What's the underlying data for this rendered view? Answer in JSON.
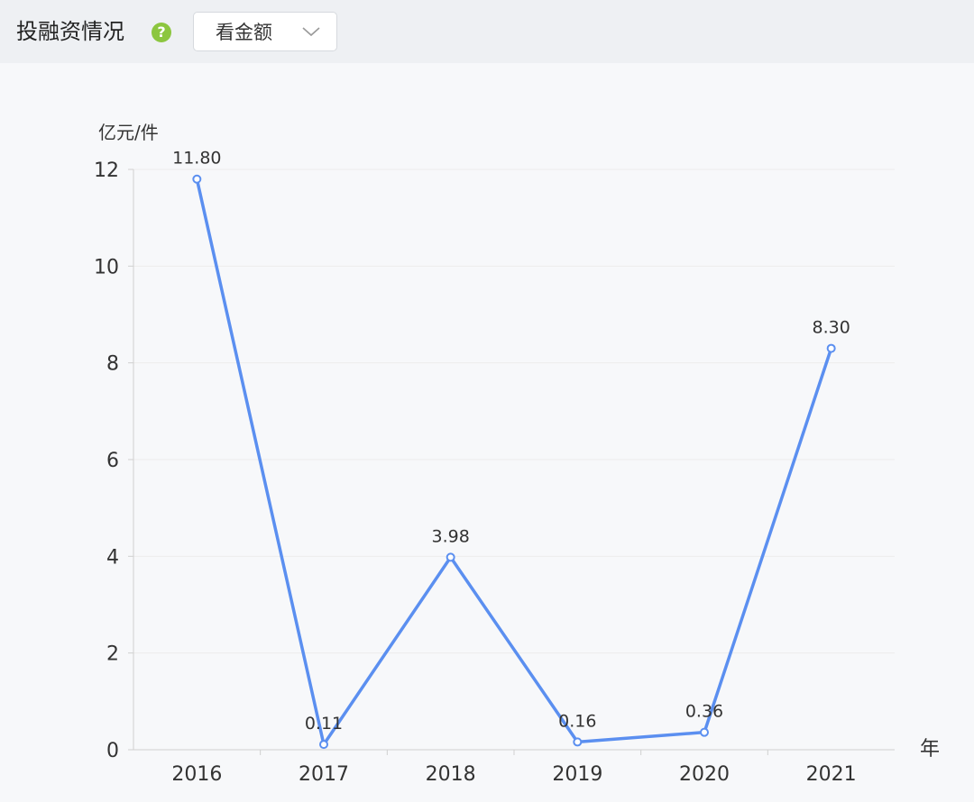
{
  "header": {
    "title": "投融资情况",
    "help_icon": "question-circle-icon",
    "select_value": "看金额",
    "chevron_icon": "chevron-down-icon"
  },
  "colors": {
    "line": "#5b8ff0",
    "help_badge": "#8cc63f",
    "grid": "#ececec"
  },
  "chart_data": {
    "type": "line",
    "title": "",
    "ylabel": "亿元/件",
    "xlabel": "年",
    "categories": [
      "2016",
      "2017",
      "2018",
      "2019",
      "2020",
      "2021"
    ],
    "values": [
      11.8,
      0.11,
      3.98,
      0.16,
      0.36,
      8.3
    ],
    "value_labels": [
      "11.80",
      "0.11",
      "3.98",
      "0.16",
      "0.36",
      "8.30"
    ],
    "ylim": [
      0,
      12
    ],
    "yticks": [
      "0",
      "2",
      "4",
      "6",
      "8",
      "10",
      "12"
    ],
    "grid": true,
    "legend": "none"
  }
}
